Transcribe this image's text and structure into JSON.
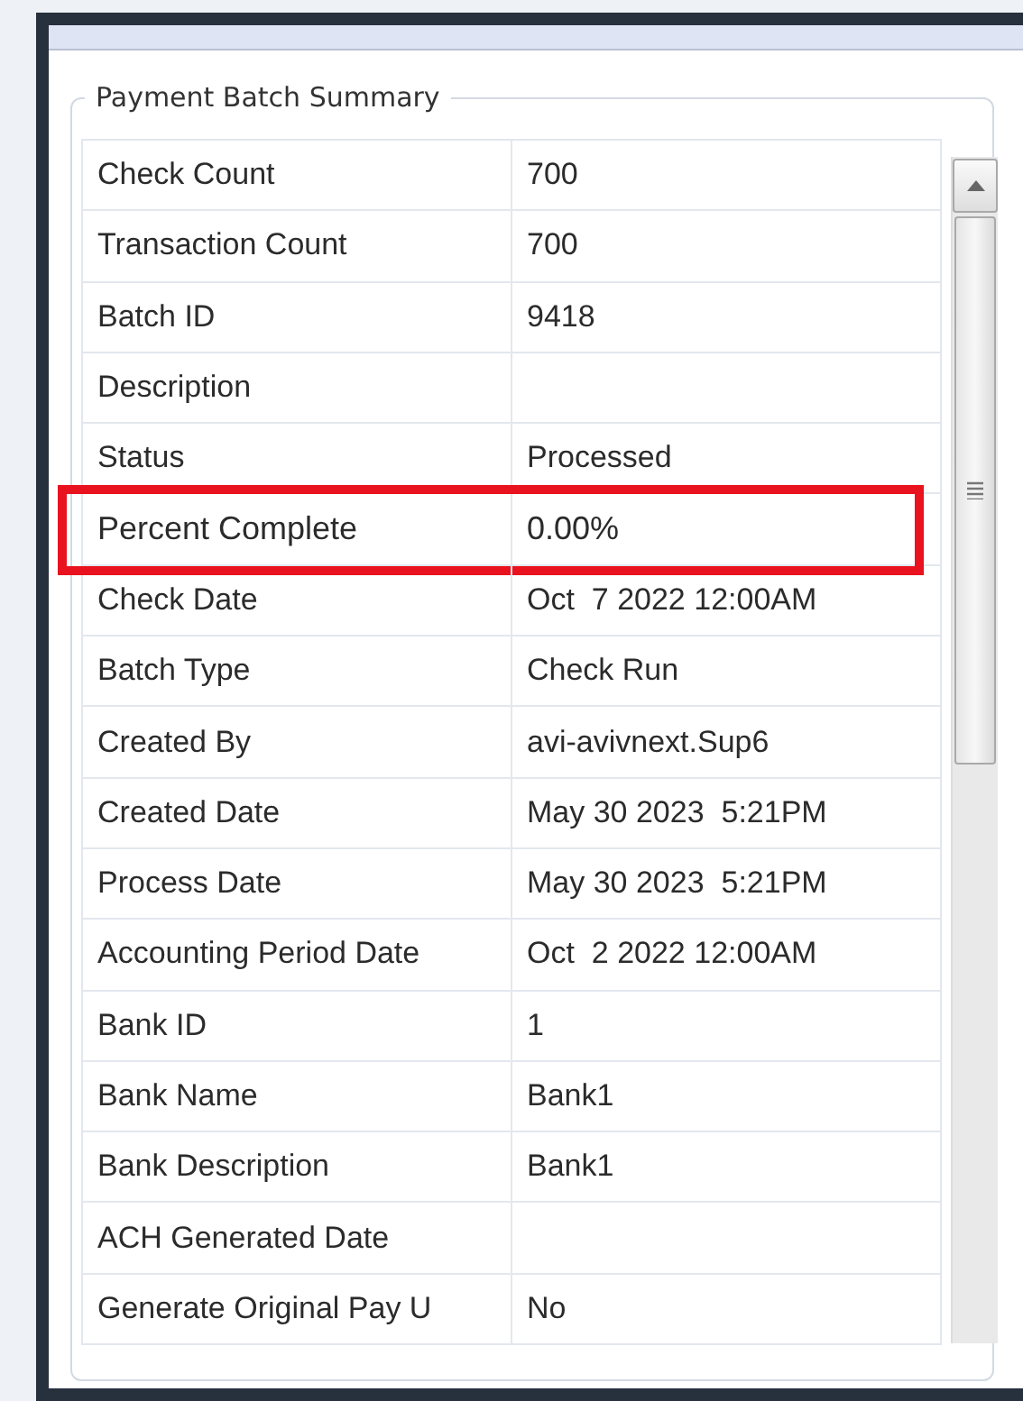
{
  "group": {
    "title": "Payment Batch Summary"
  },
  "rows": [
    {
      "label": "Check Count",
      "value": "700",
      "highlighted": false
    },
    {
      "label": "Transaction Count",
      "value": "700",
      "highlighted": false
    },
    {
      "label": "Batch ID",
      "value": "9418",
      "highlighted": false
    },
    {
      "label": "Description",
      "value": "",
      "highlighted": false
    },
    {
      "label": "Status",
      "value": "Processed",
      "highlighted": false
    },
    {
      "label": "Percent Complete",
      "value": "0.00%",
      "highlighted": true
    },
    {
      "label": "Check Date",
      "value": "Oct  7 2022 12:00AM",
      "highlighted": false
    },
    {
      "label": "Batch Type",
      "value": "Check Run",
      "highlighted": false
    },
    {
      "label": "Created By",
      "value": "avi-avivnext.Sup6",
      "highlighted": false
    },
    {
      "label": "Created Date",
      "value": "May 30 2023  5:21PM",
      "highlighted": false
    },
    {
      "label": "Process Date",
      "value": "May 30 2023  5:21PM",
      "highlighted": false
    },
    {
      "label": "Accounting Period Date",
      "value": "Oct  2 2022 12:00AM",
      "highlighted": false
    },
    {
      "label": "Bank ID",
      "value": "1",
      "highlighted": false
    },
    {
      "label": "Bank Name",
      "value": "Bank1",
      "highlighted": false
    },
    {
      "label": "Bank Description",
      "value": "Bank1",
      "highlighted": false
    },
    {
      "label": "ACH Generated Date",
      "value": "",
      "highlighted": false
    },
    {
      "label": "Generate Original Pay U",
      "value": "No",
      "highlighted": false
    }
  ]
}
